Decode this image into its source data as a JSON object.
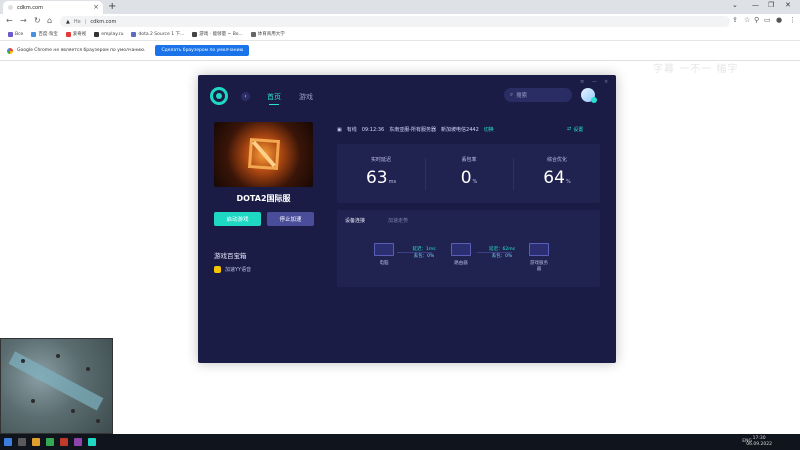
{
  "browser": {
    "tab_title": "cdkm.com",
    "url_prefix": "Не",
    "url": "cdkm.com",
    "bookmarks": [
      {
        "label": "Все",
        "color": "#6a5acd"
      },
      {
        "label": "百度·淘宝",
        "color": "#4a90e2"
      },
      {
        "label": "爱奇视",
        "color": "#e53935"
      },
      {
        "label": "emplay.ru",
        "color": "#333333"
      },
      {
        "label": "dota 2 Source 1 下...",
        "color": "#5c6bc0"
      },
      {
        "label": "游戏 · 能够量 ~ Bo...",
        "color": "#444444"
      },
      {
        "label": "体育商用大学",
        "color": "#666666"
      }
    ],
    "infobar_text": "Google Chrome не является браузером по умолчанию.",
    "infobar_button": "Сделать браузером по умолчанию"
  },
  "app": {
    "nav_home": "首页",
    "nav_games": "游戏",
    "search_placeholder": "搜索",
    "game_title": "DOTA2国际服",
    "start_button": "启动游戏",
    "stop_button": "停止加速",
    "toolbox_title": "游戏百宝箱",
    "toolbox_item": "加速YY语音",
    "status": {
      "state": "有线",
      "time": "09:12:36",
      "server": "东南亚服-所有服务器",
      "node": "新加坡电信2442",
      "switch": "切换"
    },
    "settings": "设置",
    "stats": [
      {
        "label": "实时延迟",
        "value": "63",
        "unit": "ms"
      },
      {
        "label": "丢包率",
        "value": "0",
        "unit": "%"
      },
      {
        "label": "综合优化",
        "value": "64",
        "unit": "%"
      }
    ],
    "route_tabs": [
      "设备连接",
      "加速走势"
    ],
    "route_nodes": [
      "电脑",
      "路由器",
      "游戏服务器"
    ],
    "route_links": [
      {
        "latency": "延迟：1ms",
        "loss": "丢包：0%"
      },
      {
        "latency": "延迟：62ms",
        "loss": "丢包：0%"
      }
    ]
  },
  "desktop": {
    "ghost_text": "字幕 一不一 幅字",
    "lang": "ENG",
    "time": "17:30",
    "date": "06.09.2022"
  },
  "colors": {
    "app_bg": "#1a1c46",
    "accent": "#1ed8c4",
    "panel": "#20234f"
  }
}
